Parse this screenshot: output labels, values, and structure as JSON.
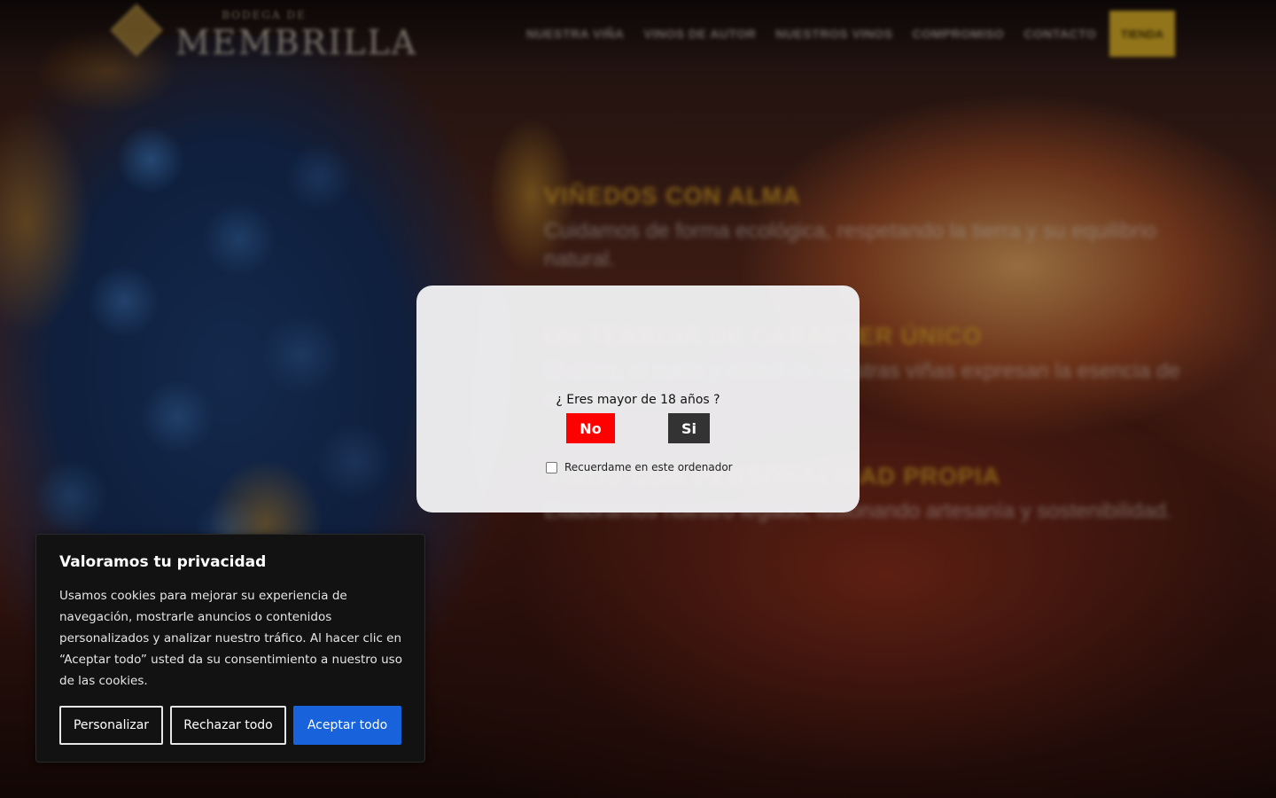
{
  "site": {
    "logo_top": "BODEGA DE",
    "logo_main": "MEMBRILLA",
    "nav": [
      "NUESTRA VIÑA",
      "VINOS DE AUTOR",
      "NUESTROS VINOS",
      "COMPROMISO",
      "CONTACTO"
    ],
    "shop_label": "TIENDA"
  },
  "hero": [
    {
      "title": "VIÑEDOS CON ALMA",
      "text": "Cuidamos de forma ecológica, respetando la tierra y su equilibrio natural."
    },
    {
      "title": "UN TERROIR DE CARÁCTER ÚNICO",
      "text": "El clima, el suelo y altitud de nuestras viñas expresan la esencia de nuestra tierra."
    },
    {
      "title": "VINOS CON PERSONALIDAD PROPIA",
      "text": "Elaboramos nuestro legado, fusionando artesanía y sostenibilidad."
    }
  ],
  "age_gate": {
    "question": "¿ Eres mayor de 18 años ?",
    "no_label": "No",
    "yes_label": "Si",
    "remember_label": "Recuerdame en este ordenador",
    "remember_checked": false,
    "colors": {
      "no": "#ff0000",
      "yes": "#333333"
    }
  },
  "cookie_banner": {
    "title": "Valoramos tu privacidad",
    "text": "Usamos cookies para mejorar su experiencia de navegación, mostrarle anuncios o contenidos personalizados y analizar nuestro tráfico. Al hacer clic en “Aceptar todo” usted da su consentimiento a nuestro uso de las cookies.",
    "customize_label": "Personalizar",
    "reject_label": "Rechazar todo",
    "accept_label": "Aceptar todo",
    "colors": {
      "background": "#121212",
      "accept": "#1863dc"
    }
  }
}
